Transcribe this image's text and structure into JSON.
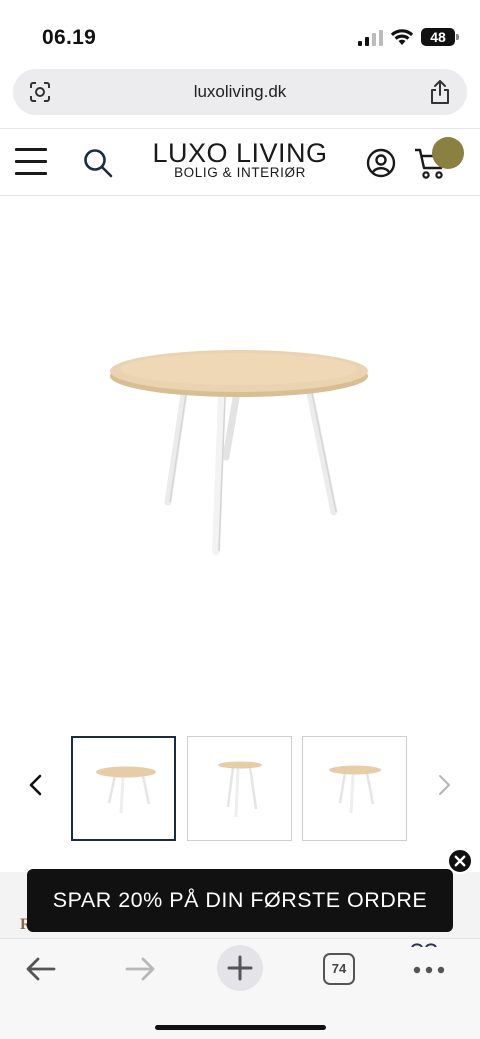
{
  "status_bar": {
    "time": "06.19",
    "battery": "48"
  },
  "browser": {
    "url": "luxoliving.dk",
    "tabs_count": "74"
  },
  "header": {
    "logo_main": "LUXO LIVING",
    "logo_sub": "BOLIG & INTERIØR"
  },
  "promo": {
    "text": "SPAR 20% PÅ DIN FØRSTE ORDRE",
    "peek": "R"
  },
  "colors": {
    "cart_badge": "#8a8040",
    "table_top": "#ead3b0",
    "table_legs": "#f2f2f2",
    "thumb_active_border": "#1d2a44"
  },
  "icons": [
    "signal-icon",
    "wifi-icon",
    "battery-icon",
    "page-tools-icon",
    "share-icon",
    "menu-icon",
    "search-icon",
    "account-icon",
    "cart-icon",
    "chevron-left-icon",
    "chevron-right-icon",
    "close-icon",
    "back-icon",
    "forward-icon",
    "plus-icon",
    "more-icon"
  ]
}
